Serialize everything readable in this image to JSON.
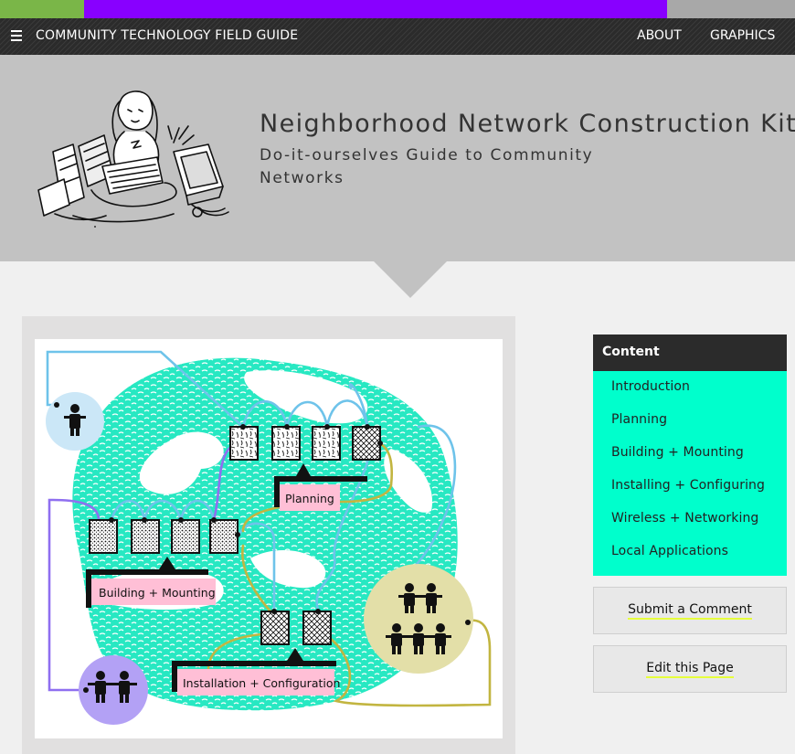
{
  "strip": {
    "colors": [
      "#7ab648",
      "#8800ff",
      "#a8a8a8"
    ]
  },
  "nav": {
    "menu_icon": "hamburger-menu-icon",
    "title": "COMMUNITY TECHNOLOGY FIELD GUIDE",
    "links": [
      "ABOUT",
      "GRAPHICS"
    ]
  },
  "header": {
    "title": "Neighborhood Network Construction Kit",
    "subtitle": "Do-it-ourselves Guide to Community Networks"
  },
  "diagram": {
    "labels": {
      "planning": "Planning",
      "building": "Building + Mounting",
      "installation": "Installation + Configuration"
    },
    "colors": {
      "teal": "#27e8c2",
      "pink": "#ffbfd6",
      "light_blue": "#cbe7f7",
      "purple": "#b3a1f5",
      "khaki": "#e3dfa8",
      "blue_line": "#6ec3ea",
      "purple_line": "#8f6ff0",
      "olive_line": "#c2b540"
    }
  },
  "sidebar": {
    "heading": "Content",
    "items": [
      "Introduction",
      "Planning",
      "Building + Mounting",
      "Installing + Configuring",
      "Wireless + Networking",
      "Local Applications"
    ],
    "background": "#00ffcc"
  },
  "buttons": {
    "comment": "Submit a Comment",
    "edit": "Edit this Page"
  }
}
